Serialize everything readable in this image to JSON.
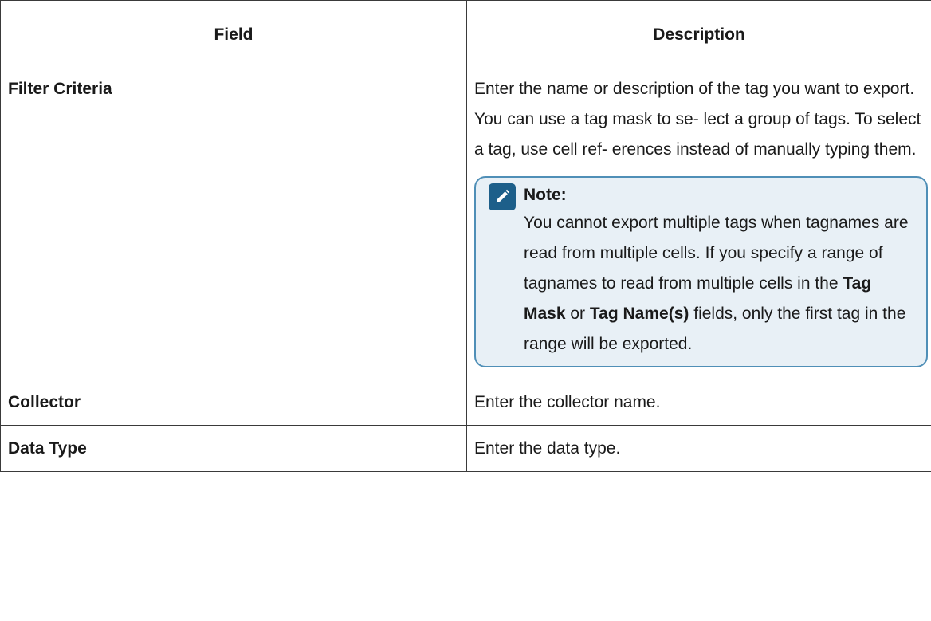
{
  "table": {
    "header": {
      "field": "Field",
      "description": "Description"
    },
    "rows": [
      {
        "field": "Filter Criteria",
        "description": "Enter the name or description of the tag you want to export. You can use a tag mask to se- lect a group of tags. To select a tag, use cell ref- erences instead of manually typing them."
      },
      {
        "field": "Collector",
        "description": "Enter the collector name."
      },
      {
        "field": "Data Type",
        "description": "Enter the data type."
      }
    ],
    "note": {
      "icon": "edit-pencil-icon",
      "title": "Note:",
      "text_part1": "You cannot export multiple tags when tagnames are read from multiple cells. If you specify a range of tagnames to read from multiple cells in the",
      "term1": "Tag Mask",
      "text_part2": "or",
      "term2": "Tag Name(s)",
      "text_part3": "fields, only the first tag in the range will be exported."
    }
  },
  "colors": {
    "border": "#3a3a3a",
    "note_border": "#4f8fb7",
    "note_background": "#e8f0f6",
    "note_icon": "#1d5f8a"
  }
}
